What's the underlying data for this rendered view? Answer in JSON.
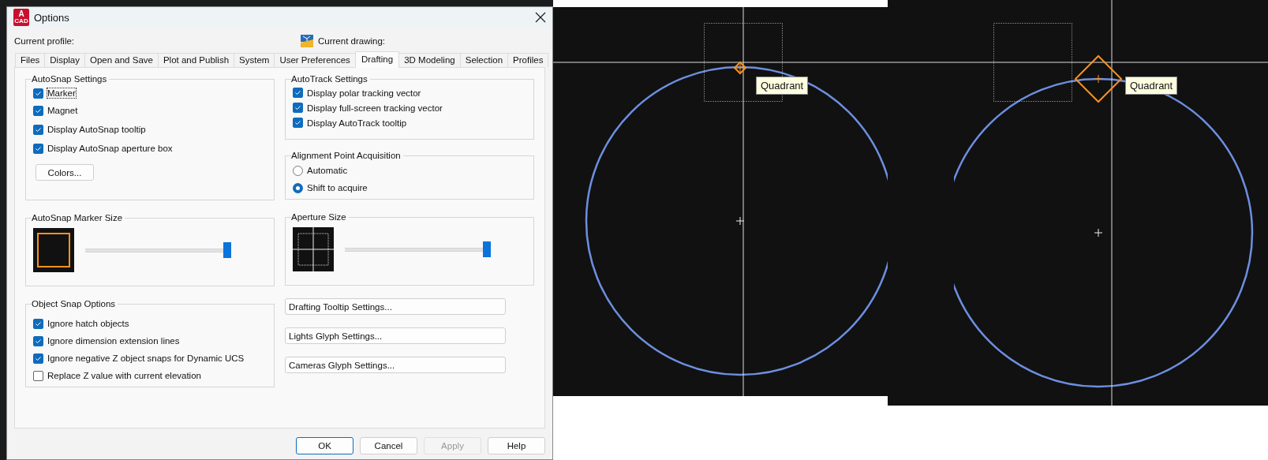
{
  "window": {
    "title": "Options",
    "app_icon": {
      "letter": "A",
      "caption": "CAD"
    }
  },
  "current_profile_label": "Current profile:",
  "current_drawing_label": "Current drawing:",
  "tabs": [
    {
      "label": "Files",
      "selected": false
    },
    {
      "label": "Display",
      "selected": false
    },
    {
      "label": "Open and Save",
      "selected": false
    },
    {
      "label": "Plot and Publish",
      "selected": false
    },
    {
      "label": "System",
      "selected": false
    },
    {
      "label": "User Preferences",
      "selected": false
    },
    {
      "label": "Drafting",
      "selected": true
    },
    {
      "label": "3D Modeling",
      "selected": false
    },
    {
      "label": "Selection",
      "selected": false
    },
    {
      "label": "Profiles",
      "selected": false
    }
  ],
  "autosnap_settings": {
    "title": "AutoSnap Settings",
    "options": [
      {
        "label": "Marker",
        "checked": true,
        "focused": true
      },
      {
        "label": "Magnet",
        "checked": true,
        "focused": false
      },
      {
        "label": "Display AutoSnap tooltip",
        "checked": true,
        "focused": false
      },
      {
        "label": "Display AutoSnap aperture box",
        "checked": true,
        "focused": false
      }
    ],
    "colors_button": "Colors..."
  },
  "autotrack_settings": {
    "title": "AutoTrack Settings",
    "options": [
      {
        "label": "Display polar tracking vector",
        "checked": true
      },
      {
        "label": "Display full-screen tracking vector",
        "checked": true
      },
      {
        "label": "Display AutoTrack tooltip",
        "checked": true
      }
    ]
  },
  "alignment_point_acquisition": {
    "title": "Alignment Point Acquisition",
    "options": [
      {
        "label": "Automatic",
        "selected": false
      },
      {
        "label": "Shift to acquire",
        "selected": true
      }
    ]
  },
  "autosnap_marker_size": {
    "title": "AutoSnap Marker Size",
    "level": 1
  },
  "aperture_size": {
    "title": "Aperture Size",
    "level": 1
  },
  "object_snap_options": {
    "title": "Object Snap Options",
    "options": [
      {
        "label": "Ignore hatch objects",
        "checked": true
      },
      {
        "label": "Ignore dimension extension lines",
        "checked": true
      },
      {
        "label": "Ignore negative Z object snaps for Dynamic UCS",
        "checked": true
      },
      {
        "label": "Replace Z value with current elevation",
        "checked": false
      }
    ]
  },
  "setting_buttons": [
    "Drafting Tooltip Settings...",
    "Lights Glyph Settings...",
    "Cameras Glyph Settings..."
  ],
  "dialog_buttons": [
    {
      "label": "OK",
      "default": true,
      "disabled": false
    },
    {
      "label": "Cancel",
      "default": false,
      "disabled": false
    },
    {
      "label": "Apply",
      "default": false,
      "disabled": true
    },
    {
      "label": "Help",
      "default": false,
      "disabled": false
    }
  ],
  "viewports": [
    {
      "tooltip": "Quadrant",
      "kind": "small"
    },
    {
      "tooltip": "Quadrant",
      "kind": "large"
    }
  ]
}
